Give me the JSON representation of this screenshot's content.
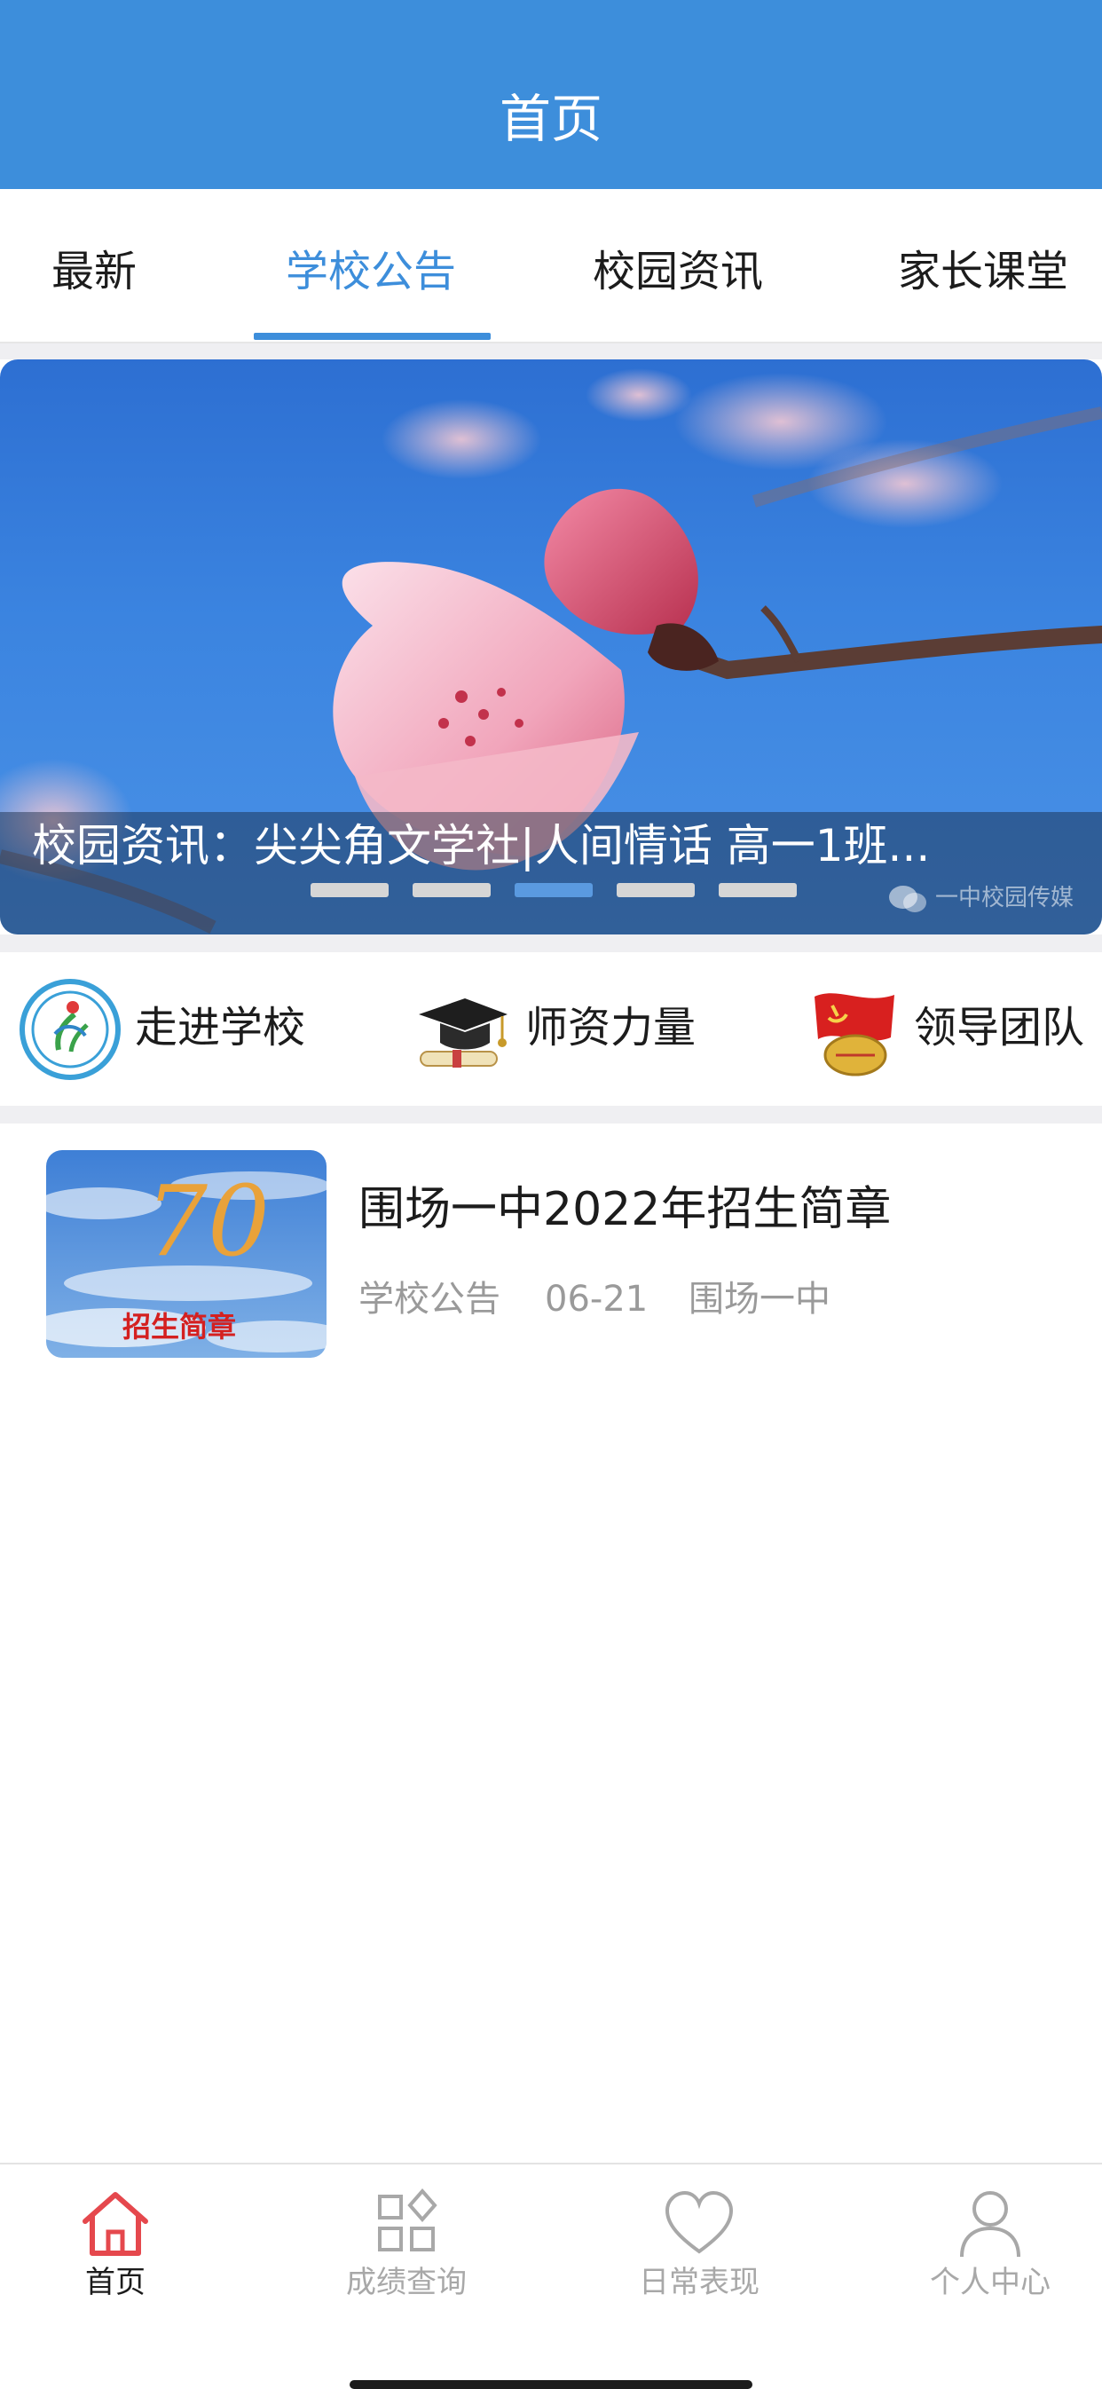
{
  "header": {
    "title": "首页"
  },
  "tabs": [
    {
      "label": "最新",
      "active": false
    },
    {
      "label": "学校公告",
      "active": true
    },
    {
      "label": "校园资讯",
      "active": false
    },
    {
      "label": "家长课堂",
      "active": false
    }
  ],
  "banner": {
    "caption": "校园资讯：尖尖角文学社|人间情话 高一1班...",
    "watermark": "一中校园传媒",
    "slide_count": 5,
    "active_slide": 3
  },
  "quick_links": [
    {
      "label": "走进学校",
      "icon": "school-logo-icon"
    },
    {
      "label": "师资力量",
      "icon": "graduation-cap-icon"
    },
    {
      "label": "领导团队",
      "icon": "party-badge-icon"
    }
  ],
  "articles": [
    {
      "title": "围场一中2022年招生简章",
      "category": "学校公告",
      "date": "06-21",
      "source": "围场一中",
      "thumb_caption": "招生简章",
      "thumb_mark": "70"
    }
  ],
  "bottom_nav": [
    {
      "label": "首页",
      "icon": "home-icon",
      "active": true
    },
    {
      "label": "成绩查询",
      "icon": "grid-icon",
      "active": false
    },
    {
      "label": "日常表现",
      "icon": "heart-icon",
      "active": false
    },
    {
      "label": "个人中心",
      "icon": "person-icon",
      "active": false
    }
  ],
  "colors": {
    "primary": "#3d8edb",
    "active_nav": "#e5484d",
    "inactive_nav": "#a8a8a8",
    "background_gap": "#efeff2"
  }
}
